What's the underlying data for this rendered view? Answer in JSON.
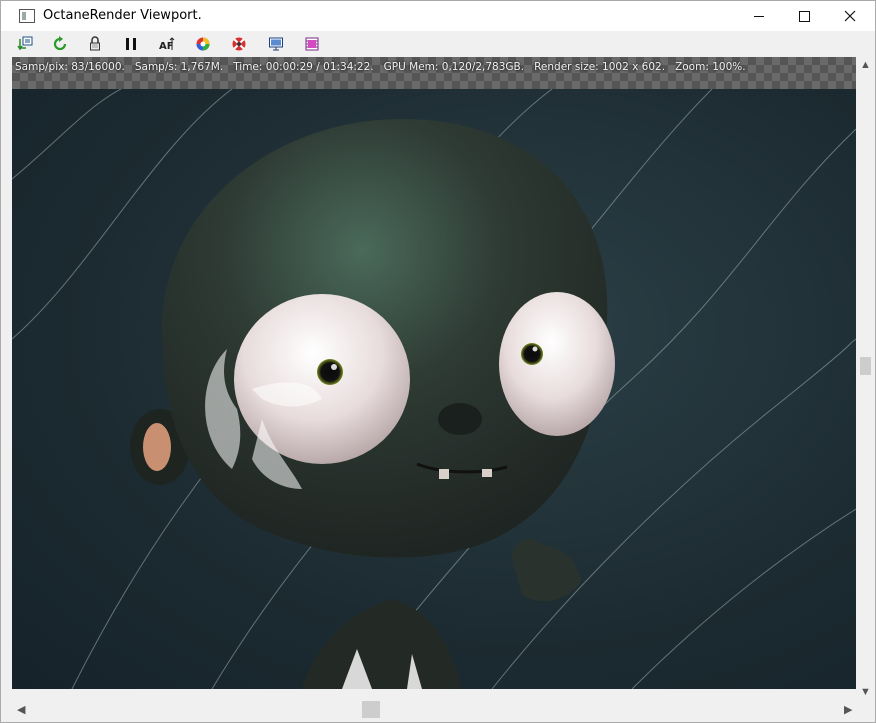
{
  "window": {
    "title": "OctaneRender Viewport.",
    "minimize_icon": "minimize-icon",
    "maximize_icon": "maximize-icon",
    "close_icon": "close-icon"
  },
  "toolbar": {
    "items": [
      {
        "name": "recenter-view",
        "icon": "recenter-icon"
      },
      {
        "name": "restart-render",
        "icon": "restart-icon"
      },
      {
        "name": "lock-resolution",
        "icon": "lock-icon"
      },
      {
        "name": "pause-render",
        "icon": "pause-icon"
      },
      {
        "name": "autofocus-picker",
        "icon": "autofocus-icon"
      },
      {
        "name": "material-picker",
        "icon": "color-wheel-icon"
      },
      {
        "name": "object-picker",
        "icon": "picker-icon"
      },
      {
        "name": "display-settings",
        "icon": "monitor-icon"
      },
      {
        "name": "film-region",
        "icon": "film-icon"
      }
    ]
  },
  "status": {
    "text": "Samp/pix: 83/16000.   Samp/s: 1,767M.   Time: 00:00:29 / 01:34:22.   GPU Mem: 0,120/2,783GB.   Render size: 1002 x 602.   Zoom: 100%."
  },
  "render": {
    "subject": "cartoon character render",
    "background_color": "#1c2b31",
    "body_color": "#2f3a34",
    "eye_color": "#e9e2e0"
  },
  "scrollbars": {
    "up_arrow": "chevron-up-icon",
    "down_arrow": "chevron-down-icon",
    "left_arrow": "chevron-left-icon",
    "right_arrow": "chevron-right-icon"
  }
}
